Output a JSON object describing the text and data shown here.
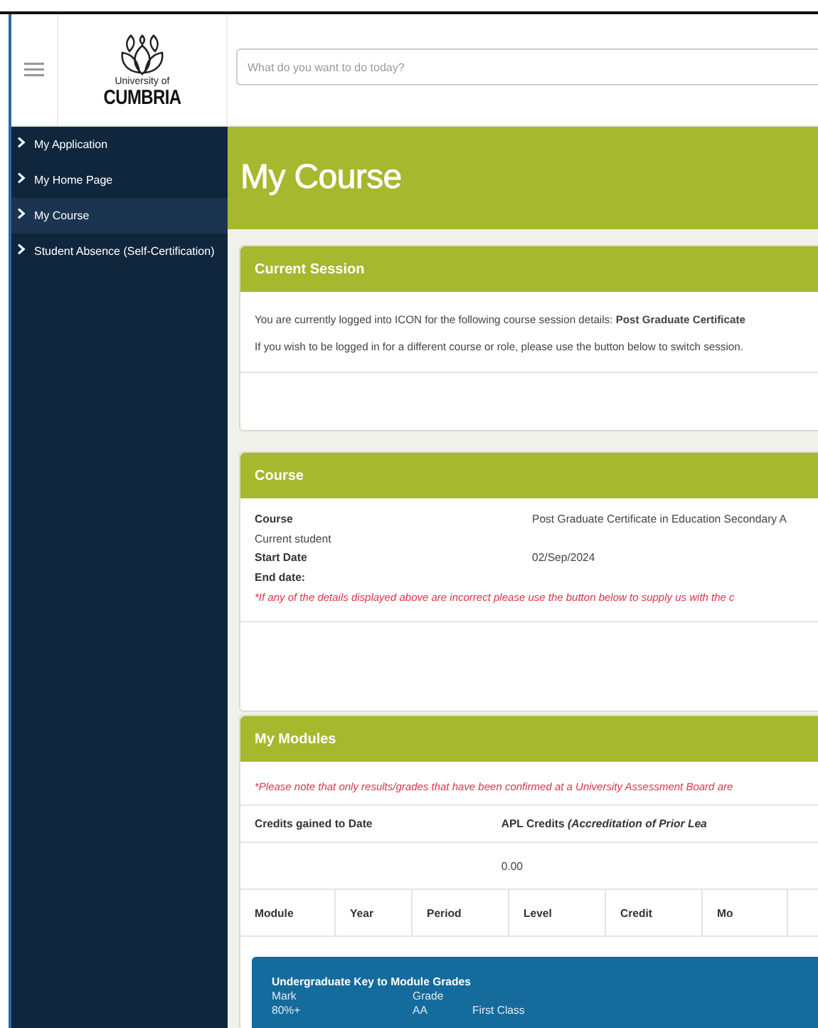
{
  "header": {
    "search_placeholder": "What do you want to do today?",
    "logo": {
      "line1": "University of",
      "line2": "CUMBRIA"
    }
  },
  "sidebar": {
    "items": [
      {
        "label": "My Application",
        "selected": false
      },
      {
        "label": "My Home Page",
        "selected": false
      },
      {
        "label": "My Course",
        "selected": true
      },
      {
        "label": "Student Absence (Self-Certification)",
        "selected": false
      }
    ]
  },
  "page_title": "My Course",
  "current_session": {
    "title": "Current Session",
    "lines": [
      "You are currently logged into ICON for the following course session details: **Post Graduate Certificate**",
      "If you wish to be logged in for a different course or role, please use the button below to switch session."
    ]
  },
  "course": {
    "title": "Course",
    "rows": [
      {
        "label": "Course",
        "bold": true,
        "value": "Post Graduate Certificate in Education Secondary A"
      },
      {
        "label": "Current student",
        "bold": false
      },
      {
        "label": "Start Date",
        "bold": true,
        "value": "02/Sep/2024"
      },
      {
        "label": "End date:",
        "bold": true
      }
    ],
    "note": "*If any of the details displayed above are incorrect please use the button below to supply us with the c"
  },
  "modules": {
    "title": "My Modules",
    "note": "*Please note that only results/grades that have been confirmed at a University Assessment Board are",
    "credits": [
      {
        "heading": "Credits gained to Date"
      },
      {
        "heading": "APL Credits *(Accreditation of Prior Lea*",
        "value": "0.00"
      }
    ],
    "columns": [
      "Module",
      "Year",
      "Period",
      "Level",
      "Credit",
      "Mo"
    ],
    "grade_key": {
      "title": "Undergraduate Key to Module Grades",
      "headers": [
        "Mark",
        "Grade"
      ],
      "rows": [
        [
          "80%+",
          "AA",
          "First Class"
        ]
      ]
    }
  }
}
